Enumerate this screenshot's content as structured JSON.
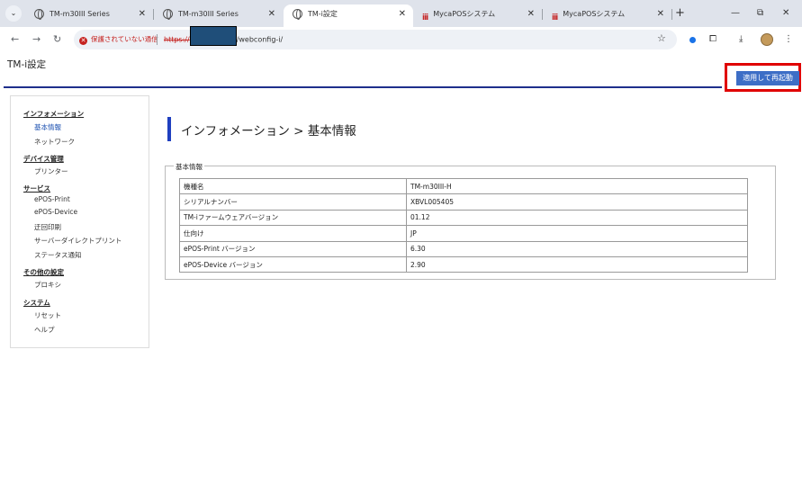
{
  "browser": {
    "tabs": [
      {
        "title": "TM-m30III Series",
        "icon": "globe-icon",
        "active": false
      },
      {
        "title": "TM-m30III Series",
        "icon": "globe-icon",
        "active": false
      },
      {
        "title": "TM-i設定",
        "icon": "globe-icon",
        "active": true
      },
      {
        "title": "MycaPOSシステム",
        "icon": "myca-logo-icon",
        "active": false
      },
      {
        "title": "MycaPOSシステム",
        "icon": "myca-logo-icon",
        "active": false
      }
    ],
    "tab_close_glyph": "✕",
    "new_tab_glyph": "+",
    "security_label": "保護されていない通信",
    "url_scheme": "https://",
    "url_path": "/webconfig-i/"
  },
  "page": {
    "header_title": "TM-i設定",
    "apply_button": "適用して再起動",
    "title": "インフォメーション > 基本情報"
  },
  "sidebar": {
    "sections": [
      {
        "heading": "インフォメーション",
        "items": [
          "基本情報",
          "ネットワーク"
        ]
      },
      {
        "heading": "デバイス管理",
        "items": [
          "プリンター"
        ]
      },
      {
        "heading": "サービス",
        "items": [
          "ePOS-Print",
          "ePOS-Device",
          "迂回印刷",
          "サーバーダイレクトプリント",
          "ステータス通知"
        ]
      },
      {
        "heading": "その他の設定",
        "items": [
          "プロキシ"
        ]
      },
      {
        "heading": "システム",
        "items": [
          "リセット",
          "ヘルプ"
        ]
      }
    ],
    "selected": "基本情報"
  },
  "info": {
    "legend": "基本情報",
    "rows": [
      {
        "label": "機種名",
        "value": "TM-m30III-H"
      },
      {
        "label": "シリアルナンバー",
        "value": "XBVL005405"
      },
      {
        "label": "TM-iファームウェアバージョン",
        "value": "01.12"
      },
      {
        "label": "仕向け",
        "value": "JP"
      },
      {
        "label": "ePOS-Print バージョン",
        "value": "6.30"
      },
      {
        "label": "ePOS-Device バージョン",
        "value": "2.90"
      }
    ]
  },
  "colors": {
    "accent_rule": "#1e2f8c",
    "apply_button": "#3d6ec6",
    "highlight_box": "#e00000",
    "selected_link": "#1a4fb0"
  }
}
